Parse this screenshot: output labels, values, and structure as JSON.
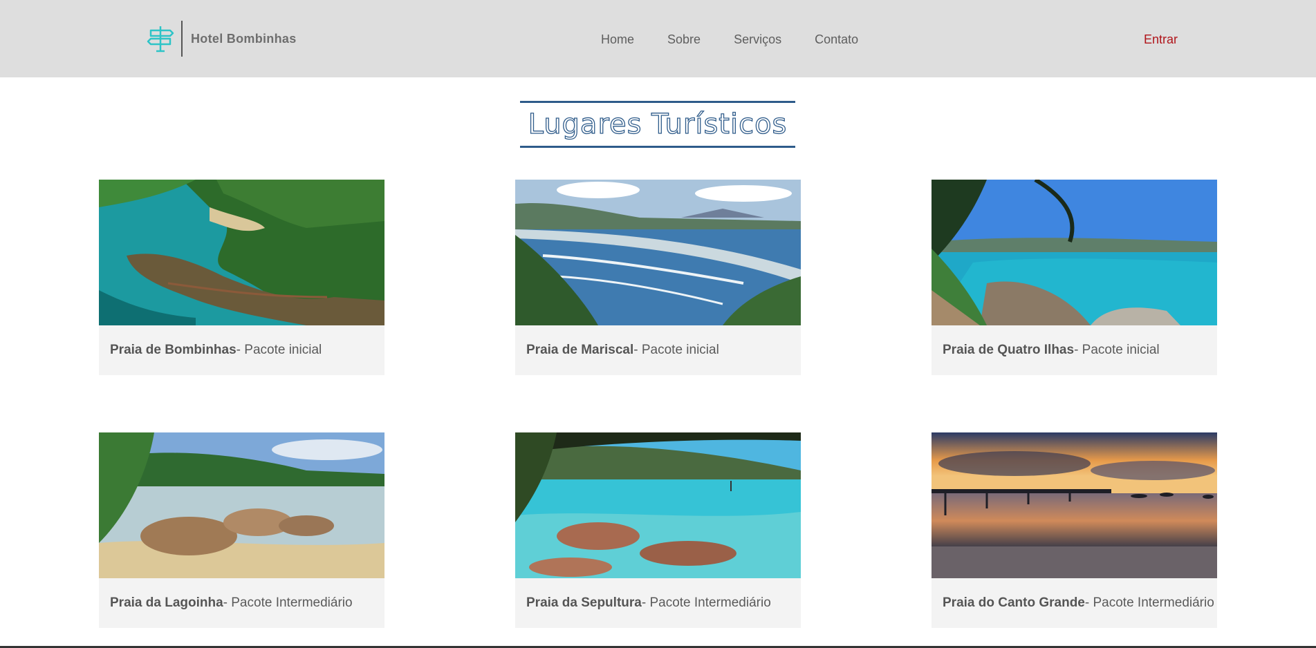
{
  "header": {
    "brand_name": "Hotel Bombinhas",
    "logo_icon": "signpost-icon",
    "nav": [
      "Home",
      "Sobre",
      "Serviços",
      "Contato"
    ],
    "login_label": "Entrar",
    "accent_color": "#b0151b",
    "logo_color": "#2ec4c7"
  },
  "main": {
    "title": "Lugares Turísticos",
    "cards": [
      {
        "place": "Praia de Bombinhas",
        "package": " - Pacote inicial"
      },
      {
        "place": "Praia de Mariscal",
        "package": " - Pacote inicial"
      },
      {
        "place": "Praia de Quatro Ilhas",
        "package": " - Pacote inicial"
      },
      {
        "place": "Praia da Lagoinha",
        "package": " - Pacote Intermediário"
      },
      {
        "place": "Praia da Sepultura",
        "package": " - Pacote Intermediário"
      },
      {
        "place": "Praia do Canto Grande",
        "package": " - Pacote Intermediário"
      }
    ]
  }
}
